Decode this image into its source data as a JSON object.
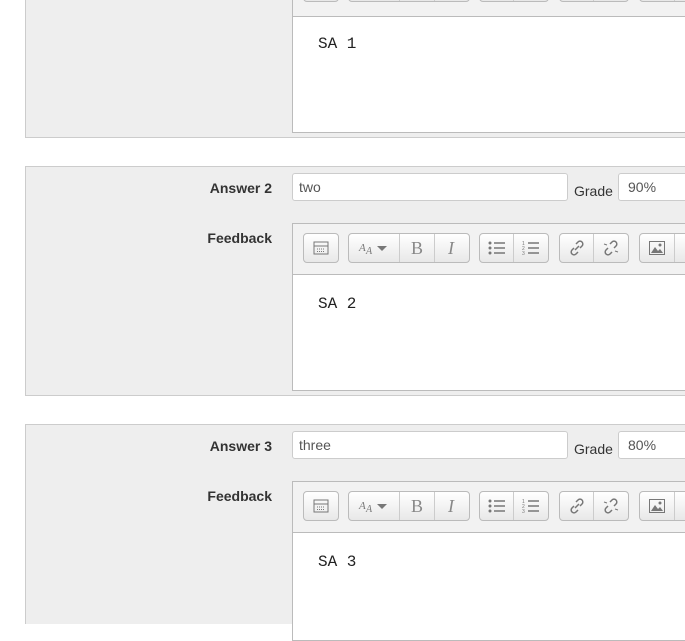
{
  "answers": [
    {
      "feedback_content": "SA 1"
    },
    {
      "label": "Answer 2",
      "value": "two",
      "grade_label": "Grade",
      "grade": "90%",
      "feedback_label": "Feedback",
      "feedback_content": "SA 2"
    },
    {
      "label": "Answer 3",
      "value": "three",
      "grade_label": "Grade",
      "grade": "80%",
      "feedback_label": "Feedback",
      "feedback_content": "SA 3"
    }
  ],
  "toolbar_icons": [
    "toolbar-toggle-icon",
    "font-size-icon",
    "bold-icon",
    "italic-icon",
    "bullet-list-icon",
    "numbered-list-icon",
    "link-icon",
    "unlink-icon",
    "image-icon",
    "media-icon"
  ],
  "colors": {
    "panel_bg": "#eeeeee",
    "border": "#cccccc",
    "toolbar_bg": "#f2f2f2"
  }
}
